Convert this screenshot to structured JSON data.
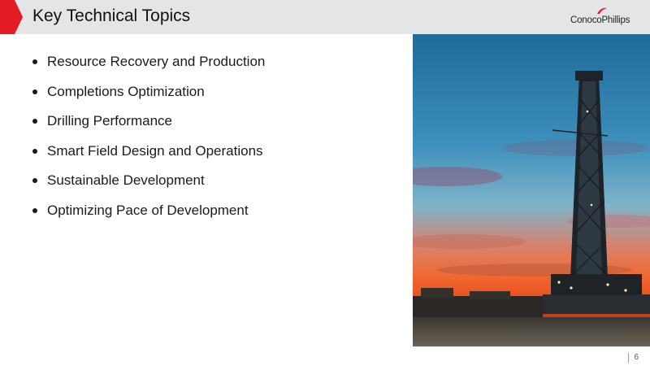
{
  "header": {
    "title": "Key Technical Topics",
    "logo_text": "ConocoPhillips",
    "accent_color": "#e31b23"
  },
  "bullets": [
    "Resource Recovery and Production",
    "Completions Optimization",
    "Drilling Performance",
    "Smart Field Design and Operations",
    "Sustainable Development",
    "Optimizing Pace of Development"
  ],
  "footer": {
    "page_number": "6"
  }
}
